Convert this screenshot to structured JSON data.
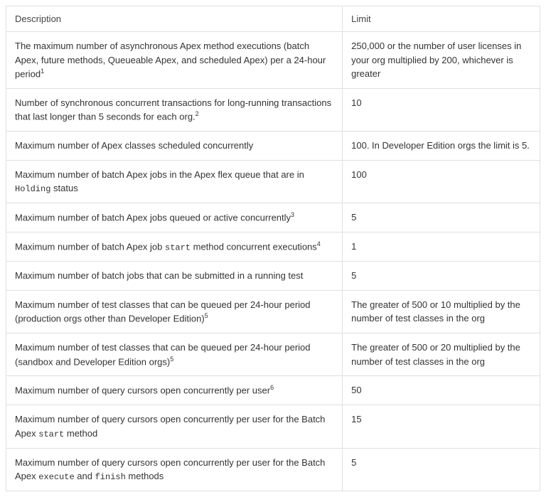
{
  "table": {
    "headers": {
      "description": "Description",
      "limit": "Limit"
    },
    "rows": [
      {
        "desc_parts": [
          {
            "t": "text",
            "v": "The maximum number of asynchronous Apex method executions (batch Apex, future methods, Queueable Apex, and scheduled Apex) per a 24-hour period"
          },
          {
            "t": "sup",
            "v": "1"
          }
        ],
        "limit_parts": [
          {
            "t": "text",
            "v": "250,000 or the number of user licenses in your org multiplied by 200, whichever is greater"
          }
        ]
      },
      {
        "desc_parts": [
          {
            "t": "text",
            "v": "Number of synchronous concurrent transactions for long-running transactions that last longer than 5 seconds for each org."
          },
          {
            "t": "sup",
            "v": "2"
          }
        ],
        "limit_parts": [
          {
            "t": "text",
            "v": "10"
          }
        ]
      },
      {
        "desc_parts": [
          {
            "t": "text",
            "v": "Maximum number of Apex classes scheduled concurrently"
          }
        ],
        "limit_parts": [
          {
            "t": "text",
            "v": "100. In Developer Edition orgs the limit is 5."
          }
        ]
      },
      {
        "desc_parts": [
          {
            "t": "text",
            "v": "Maximum number of batch Apex jobs in the Apex flex queue that are in "
          },
          {
            "t": "code",
            "v": "Holding"
          },
          {
            "t": "text",
            "v": " status"
          }
        ],
        "limit_parts": [
          {
            "t": "text",
            "v": "100"
          }
        ]
      },
      {
        "desc_parts": [
          {
            "t": "text",
            "v": "Maximum number of batch Apex jobs queued or active concurrently"
          },
          {
            "t": "sup",
            "v": "3"
          }
        ],
        "limit_parts": [
          {
            "t": "text",
            "v": "5"
          }
        ]
      },
      {
        "desc_parts": [
          {
            "t": "text",
            "v": "Maximum number of batch Apex job "
          },
          {
            "t": "code",
            "v": "start"
          },
          {
            "t": "text",
            "v": " method concurrent executions"
          },
          {
            "t": "sup",
            "v": "4"
          }
        ],
        "limit_parts": [
          {
            "t": "text",
            "v": "1"
          }
        ]
      },
      {
        "desc_parts": [
          {
            "t": "text",
            "v": "Maximum number of batch jobs that can be submitted in a running test"
          }
        ],
        "limit_parts": [
          {
            "t": "text",
            "v": "5"
          }
        ]
      },
      {
        "desc_parts": [
          {
            "t": "text",
            "v": "Maximum number of test classes that can be queued per 24-hour period (production orgs other than Developer Edition)"
          },
          {
            "t": "sup",
            "v": "5"
          }
        ],
        "limit_parts": [
          {
            "t": "text",
            "v": "The greater of 500 or 10 multiplied by the number of test classes in the org"
          }
        ]
      },
      {
        "desc_parts": [
          {
            "t": "text",
            "v": "Maximum number of test classes that can be queued per 24-hour period (sandbox and Developer Edition orgs)"
          },
          {
            "t": "sup",
            "v": "5"
          }
        ],
        "limit_parts": [
          {
            "t": "text",
            "v": "The greater of 500 or 20 multiplied by the number of test classes in the org"
          }
        ]
      },
      {
        "desc_parts": [
          {
            "t": "text",
            "v": "Maximum number of query cursors open concurrently per user"
          },
          {
            "t": "sup",
            "v": "6"
          }
        ],
        "limit_parts": [
          {
            "t": "text",
            "v": "50"
          }
        ]
      },
      {
        "desc_parts": [
          {
            "t": "text",
            "v": "Maximum number of query cursors open concurrently per user for the Batch Apex "
          },
          {
            "t": "code",
            "v": "start"
          },
          {
            "t": "text",
            "v": " method"
          }
        ],
        "limit_parts": [
          {
            "t": "text",
            "v": "15"
          }
        ]
      },
      {
        "desc_parts": [
          {
            "t": "text",
            "v": "Maximum number of query cursors open concurrently per user for the Batch Apex "
          },
          {
            "t": "code",
            "v": "execute"
          },
          {
            "t": "text",
            "v": " and "
          },
          {
            "t": "code",
            "v": "finish"
          },
          {
            "t": "text",
            "v": " methods"
          }
        ],
        "limit_parts": [
          {
            "t": "text",
            "v": "5"
          }
        ]
      }
    ]
  }
}
